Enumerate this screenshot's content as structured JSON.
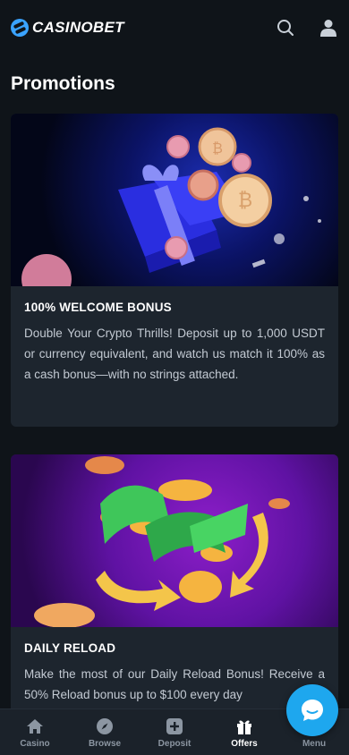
{
  "brand": {
    "name": "CASINOBET"
  },
  "page": {
    "title": "Promotions"
  },
  "promotions": [
    {
      "title": "100% WELCOME BONUS",
      "description": "Double Your Crypto Thrills! Deposit up to 1,000 USDT or currency equivalent, and watch us match it 100% as a cash bonus—with no strings attached."
    },
    {
      "title": "DAILY RELOAD",
      "description": "Make the most of our Daily Reload Bonus! Receive a 50% Reload bonus up to $100 every day"
    }
  ],
  "nav": {
    "items": [
      {
        "label": "Casino",
        "icon": "home-icon"
      },
      {
        "label": "Browse",
        "icon": "compass-icon"
      },
      {
        "label": "Deposit",
        "icon": "plus-square-icon"
      },
      {
        "label": "Offers",
        "icon": "gift-icon",
        "active": true
      },
      {
        "label": "Menu",
        "icon": "menu-icon"
      }
    ]
  },
  "colors": {
    "accent": "#1ea7ee",
    "background": "#0f1419",
    "card": "#1d252e"
  }
}
